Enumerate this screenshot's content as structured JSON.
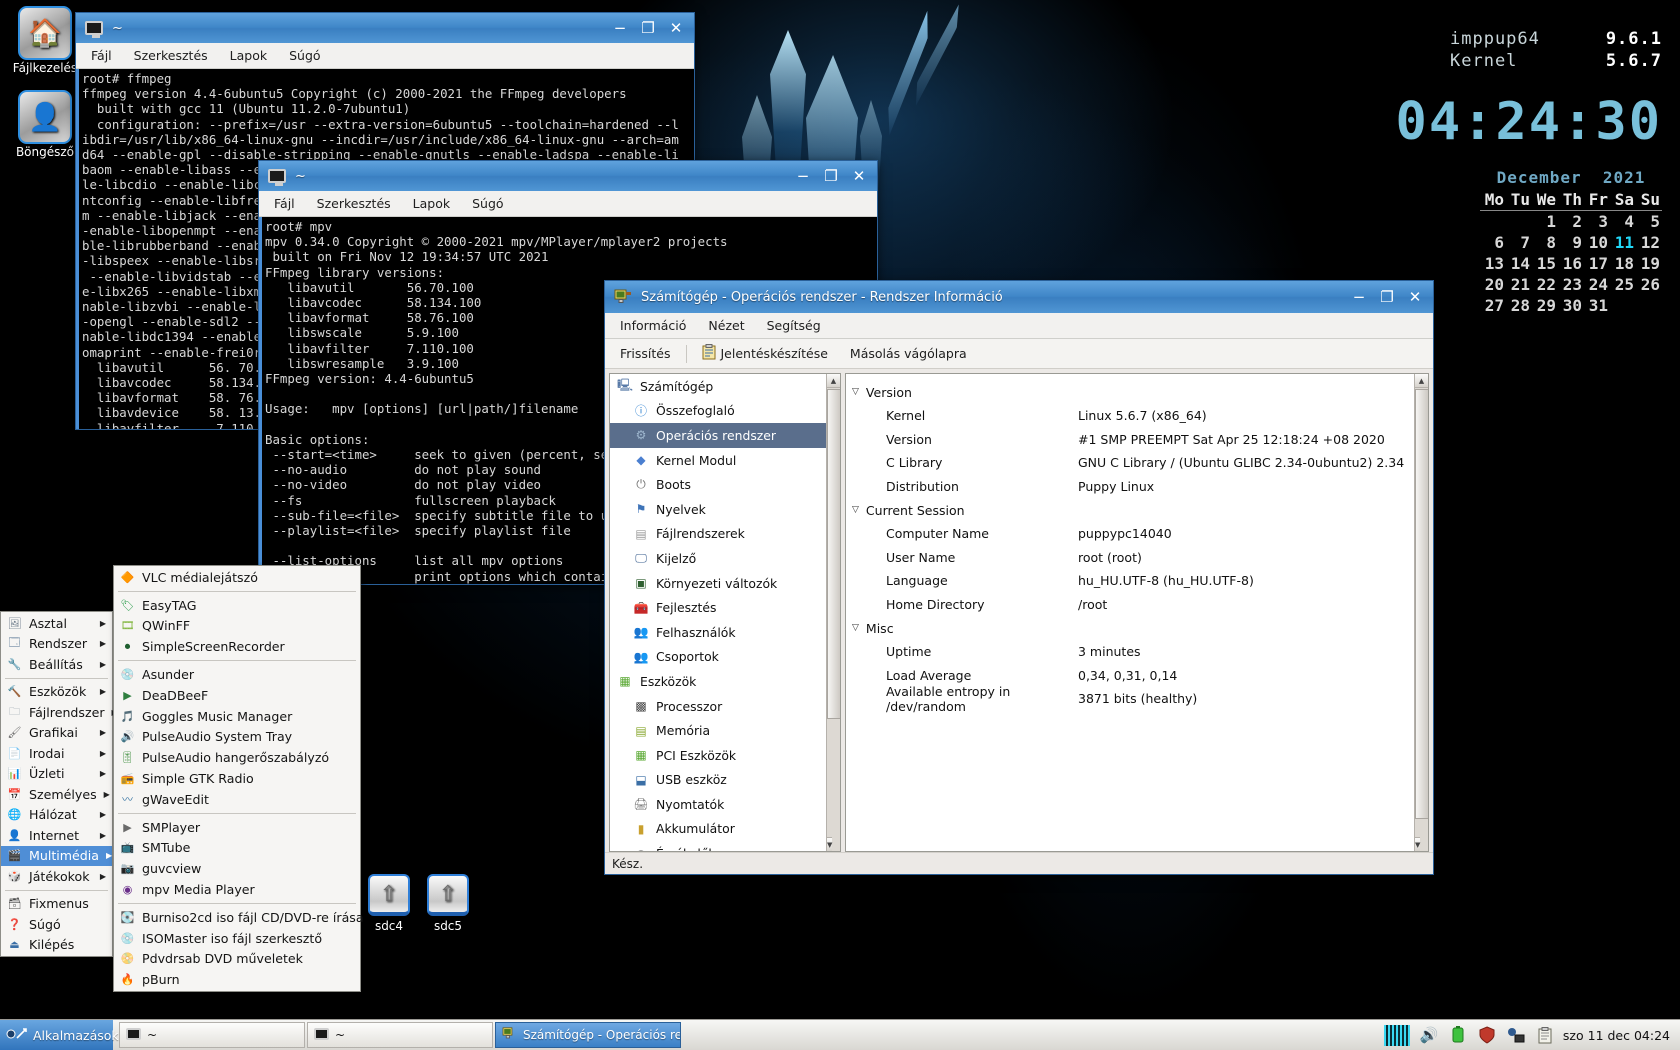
{
  "desktop": {
    "icons": [
      {
        "name": "Fájlkezelés",
        "glyph": "🏠"
      },
      {
        "name": "Böngésző",
        "glyph": "👤"
      }
    ],
    "drives": [
      {
        "name": "sdc4",
        "glyph": "⇧"
      },
      {
        "name": "sdc5",
        "glyph": "⇧"
      }
    ]
  },
  "conky": {
    "rows": [
      {
        "key": "imppup64",
        "value": "9.6.1"
      },
      {
        "key": "Kernel",
        "value": "5.6.7"
      }
    ],
    "clock": "04:24:30",
    "calendar": {
      "month": "December",
      "year": "2021",
      "weekdays": [
        "Mo",
        "Tu",
        "We",
        "Th",
        "Fr",
        "Sa",
        "Su"
      ],
      "weeks": [
        [
          "",
          "",
          "1",
          "2",
          "3",
          "4",
          "5"
        ],
        [
          "6",
          "7",
          "8",
          "9",
          "10",
          "11",
          "12"
        ],
        [
          "13",
          "14",
          "15",
          "16",
          "17",
          "18",
          "19"
        ],
        [
          "20",
          "21",
          "22",
          "23",
          "24",
          "25",
          "26"
        ],
        [
          "27",
          "28",
          "29",
          "30",
          "31",
          "",
          ""
        ]
      ],
      "today": "11"
    }
  },
  "terminal1": {
    "title": "~",
    "icon": "monitor-icon",
    "menu": [
      "Fájl",
      "Szerkesztés",
      "Lapok",
      "Súgó"
    ],
    "buttons": {
      "minimize": "−",
      "maximize": "❐",
      "close": "✕"
    },
    "content": "root# ffmpeg\nffmpeg version 4.4-6ubuntu5 Copyright (c) 2000-2021 the FFmpeg developers\n  built with gcc 11 (Ubuntu 11.2.0-7ubuntu1)\n  configuration: --prefix=/usr --extra-version=6ubuntu5 --toolchain=hardened --l\nibdir=/usr/lib/x86_64-linux-gnu --incdir=/usr/include/x86_64-linux-gnu --arch=am\nd64 --enable-gpl --disable-stripping --enable-gnutls --enable-ladspa --enable-li\nbaom --enable-libass --e\nle-libcdio --enable-libc\nntconfig --enable-libfre\nm --enable-libjack --ena\n-enable-libopenmpt --ena\nble-librubberband --enab\n-libspeex --enable-libsr\n --enable-libvidstab --e\ne-libx265 --enable-libxm\nnable-libzvbi --enable-l\n-opengl --enable-sdl2 --\nnable-libdc1394 --enable\nomaprint --enable-frei0r\n  libavutil      56. 70.\n  libavcodec     58.134.\n  libavformat    58. 76.\n  libavdevice    58. 13.\n  libavfilter     7.110."
  },
  "terminal2": {
    "title": "~",
    "icon": "monitor-icon",
    "menu": [
      "Fájl",
      "Szerkesztés",
      "Lapok",
      "Súgó"
    ],
    "buttons": {
      "minimize": "−",
      "maximize": "❐",
      "close": "✕"
    },
    "content": "root# mpv\nmpv 0.34.0 Copyright © 2000-2021 mpv/MPlayer/mplayer2 projects\n built on Fri Nov 12 19:34:57 UTC 2021\nFFmpeg library versions:\n   libavutil       56.70.100\n   libavcodec      58.134.100\n   libavformat     58.76.100\n   libswscale      5.9.100\n   libavfilter     7.110.100\n   libswresample   3.9.100\nFFmpeg version: 4.4-6ubuntu5\n\nUsage:   mpv [options] [url|path/]filename\n\nBasic options:\n --start=<time>     seek to given (percent, sec\n --no-audio         do not play sound\n --no-video         do not play video\n --fs               fullscreen playback\n --sub-file=<file>  specify subtitle file to us\n --playlist=<file>  specify playlist file\n\n --list-options     list all mpv options\n                    print options which contain"
  },
  "sysinfo": {
    "title": "Számítógép - Operációs rendszer - Rendszer Információ",
    "icon": "computer-info-icon",
    "buttons": {
      "minimize": "−",
      "maximize": "❐",
      "close": "✕"
    },
    "menu": [
      "Információ",
      "Nézet",
      "Segítség"
    ],
    "toolbar": {
      "refresh": "Frissítés",
      "report": "Jelentéskészítése",
      "copy": "Másolás vágólapra"
    },
    "tree": [
      {
        "label": "Számítógép",
        "level": 0,
        "icon": "computer-icon",
        "selected": false
      },
      {
        "label": "Összefoglaló",
        "level": 1,
        "icon": "info-icon",
        "selected": false
      },
      {
        "label": "Operációs rendszer",
        "level": 1,
        "icon": "gear-icon",
        "selected": true
      },
      {
        "label": "Kernel Modul",
        "level": 1,
        "icon": "diamond-icon",
        "selected": false
      },
      {
        "label": "Boots",
        "level": 1,
        "icon": "power-icon",
        "selected": false
      },
      {
        "label": "Nyelvek",
        "level": 1,
        "icon": "flag-icon",
        "selected": false
      },
      {
        "label": "Fájlrendszerek",
        "level": 1,
        "icon": "disk-icon",
        "selected": false
      },
      {
        "label": "Kijelző",
        "level": 1,
        "icon": "display-icon",
        "selected": false
      },
      {
        "label": "Környezeti változók",
        "level": 1,
        "icon": "terminal-icon",
        "selected": false
      },
      {
        "label": "Fejlesztés",
        "level": 1,
        "icon": "toolbox-icon",
        "selected": false
      },
      {
        "label": "Felhasználók",
        "level": 1,
        "icon": "users-icon",
        "selected": false
      },
      {
        "label": "Csoportok",
        "level": 1,
        "icon": "users-icon",
        "selected": false
      },
      {
        "label": "Eszközök",
        "level": 0,
        "icon": "hardware-icon",
        "selected": false
      },
      {
        "label": "Processzor",
        "level": 1,
        "icon": "cpu-icon",
        "selected": false
      },
      {
        "label": "Memória",
        "level": 1,
        "icon": "memory-icon",
        "selected": false
      },
      {
        "label": "PCI Eszközök",
        "level": 1,
        "icon": "pci-icon",
        "selected": false
      },
      {
        "label": "USB eszköz",
        "level": 1,
        "icon": "usb-icon",
        "selected": false
      },
      {
        "label": "Nyomtatók",
        "level": 1,
        "icon": "printer-icon",
        "selected": false
      },
      {
        "label": "Akkumulátor",
        "level": 1,
        "icon": "battery-icon",
        "selected": false
      },
      {
        "label": "Érzékelők",
        "level": 1,
        "icon": "sensor-icon",
        "selected": false
      }
    ],
    "details": [
      {
        "type": "group",
        "label": "Version"
      },
      {
        "type": "row",
        "key": "Kernel",
        "value": "Linux 5.6.7 (x86_64)"
      },
      {
        "type": "row",
        "key": "Version",
        "value": "#1 SMP PREEMPT Sat Apr 25 12:18:24 +08 2020"
      },
      {
        "type": "row",
        "key": "C Library",
        "value": "GNU C Library / (Ubuntu GLIBC 2.34-0ubuntu2) 2.34"
      },
      {
        "type": "row",
        "key": "Distribution",
        "value": "Puppy Linux"
      },
      {
        "type": "group",
        "label": "Current Session"
      },
      {
        "type": "row",
        "key": "Computer Name",
        "value": "puppypc14040"
      },
      {
        "type": "row",
        "key": "User Name",
        "value": "root (root)"
      },
      {
        "type": "row",
        "key": "Language",
        "value": "hu_HU.UTF-8 (hu_HU.UTF-8)"
      },
      {
        "type": "row",
        "key": "Home Directory",
        "value": "/root"
      },
      {
        "type": "group",
        "label": "Misc"
      },
      {
        "type": "row",
        "key": "Uptime",
        "value": "3 minutes"
      },
      {
        "type": "row",
        "key": "Load Average",
        "value": "0,34, 0,31, 0,14"
      },
      {
        "type": "row",
        "key": "Available entropy in /dev/random",
        "value": "3871 bits (healthy)"
      }
    ],
    "status": "Kész."
  },
  "main_menu": {
    "items": [
      {
        "label": "Asztal",
        "icon": "desktop-icon",
        "submenu": true,
        "selected": false
      },
      {
        "label": "Rendszer",
        "icon": "system-icon",
        "submenu": true,
        "selected": false
      },
      {
        "label": "Beállítás",
        "icon": "settings-icon",
        "submenu": true,
        "selected": false
      },
      {
        "separator": true
      },
      {
        "label": "Eszközök",
        "icon": "tools-icon",
        "submenu": true,
        "selected": false
      },
      {
        "label": "Fájlrendszer",
        "icon": "filesystem-icon",
        "submenu": true,
        "selected": false
      },
      {
        "label": "Grafikai",
        "icon": "graphics-icon",
        "submenu": true,
        "selected": false
      },
      {
        "label": "Irodai",
        "icon": "office-icon",
        "submenu": true,
        "selected": false
      },
      {
        "label": "Üzleti",
        "icon": "business-icon",
        "submenu": true,
        "selected": false
      },
      {
        "label": "Személyes",
        "icon": "personal-icon",
        "submenu": true,
        "selected": false
      },
      {
        "label": "Hálózat",
        "icon": "network-icon",
        "submenu": true,
        "selected": false
      },
      {
        "label": "Internet",
        "icon": "internet-icon",
        "submenu": true,
        "selected": false
      },
      {
        "label": "Multimédia",
        "icon": "multimedia-icon",
        "submenu": true,
        "selected": true
      },
      {
        "label": "Játékokok",
        "icon": "games-icon",
        "submenu": true,
        "selected": false
      },
      {
        "separator": true
      },
      {
        "label": "Fixmenus",
        "icon": "fixmenus-icon",
        "submenu": false,
        "selected": false
      },
      {
        "label": "Súgó",
        "icon": "help-icon",
        "submenu": false,
        "selected": false
      },
      {
        "label": "Kilépés",
        "icon": "exit-icon",
        "submenu": false,
        "selected": false
      }
    ]
  },
  "sub_menu": {
    "items": [
      {
        "label": "VLC médialejátszó",
        "icon": "vlc-icon"
      },
      {
        "separator": true
      },
      {
        "label": "EasyTAG",
        "icon": "easytag-icon"
      },
      {
        "label": "QWinFF",
        "icon": "qwinff-icon"
      },
      {
        "label": "SimpleScreenRecorder",
        "icon": "ssr-icon"
      },
      {
        "separator": true
      },
      {
        "label": "Asunder",
        "icon": "asunder-icon"
      },
      {
        "label": "DeaDBeeF",
        "icon": "deadbeef-icon"
      },
      {
        "label": "Goggles Music Manager",
        "icon": "goggles-icon"
      },
      {
        "label": "PulseAudio System Tray",
        "icon": "pulseaudio-icon"
      },
      {
        "label": "PulseAudio hangerőszabályzó",
        "icon": "pavucontrol-icon"
      },
      {
        "label": "Simple GTK Radio",
        "icon": "radio-icon"
      },
      {
        "label": "gWaveEdit",
        "icon": "gwaveedit-icon"
      },
      {
        "separator": true
      },
      {
        "label": "SMPlayer",
        "icon": "smplayer-icon"
      },
      {
        "label": "SMTube",
        "icon": "smtube-icon"
      },
      {
        "label": "guvcview",
        "icon": "guvcview-icon"
      },
      {
        "label": "mpv Media Player",
        "icon": "mpv-icon"
      },
      {
        "separator": true
      },
      {
        "label": "Burniso2cd iso fájl CD/DVD-re írása",
        "icon": "burniso-icon"
      },
      {
        "label": "ISOMaster iso fájl szerkesztő",
        "icon": "isomaster-icon"
      },
      {
        "label": "Pdvdrsab DVD műveletek",
        "icon": "pdvdrsab-icon"
      },
      {
        "label": "pBurn",
        "icon": "pburn-icon"
      }
    ]
  },
  "taskbar": {
    "start": "Alkalmazások",
    "tasks": [
      {
        "label": "~",
        "icon": "monitor-icon",
        "active": false
      },
      {
        "label": "~",
        "icon": "monitor-icon",
        "active": false
      },
      {
        "label": "Számítógép - Operációs re",
        "icon": "computer-info-icon",
        "active": true
      }
    ],
    "tray": [
      {
        "name": "cpu-frequency-icon",
        "glyph": ""
      },
      {
        "name": "volume-icon",
        "glyph": "🔊"
      },
      {
        "name": "battery-icon",
        "glyph": "🔋"
      },
      {
        "name": "firewall-icon",
        "glyph": "🛡"
      },
      {
        "name": "network-icon",
        "glyph": "🖧"
      },
      {
        "name": "clipboard-icon",
        "glyph": "📋"
      }
    ],
    "clock": "szo 11 dec 04:24"
  }
}
